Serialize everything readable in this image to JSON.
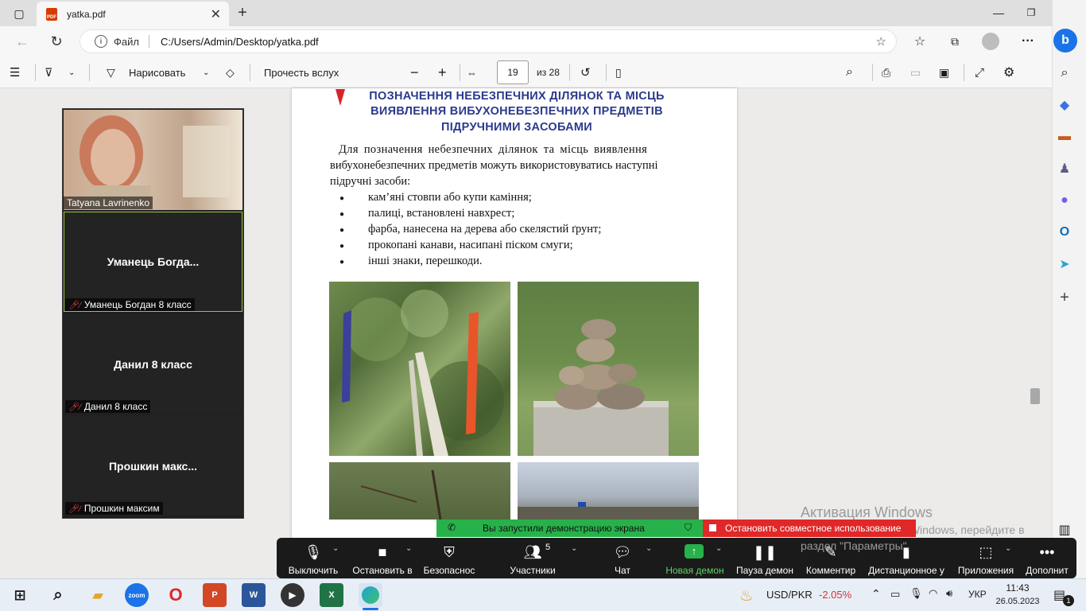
{
  "browser": {
    "tab_title": "yatka.pdf",
    "tab_close": "✕",
    "new_tab": "+",
    "address_label": "Файл",
    "address_url": "C:/Users/Admin/Desktop/yatka.pdf"
  },
  "pdf_toolbar": {
    "draw_label": "Нарисовать",
    "read_aloud": "Прочесть вслух",
    "zoom_out": "−",
    "zoom_in": "+",
    "page_current": "19",
    "page_total": "из 28"
  },
  "pdf": {
    "heading_line1": "ПОЗНАЧЕННЯ НЕБЕЗПЕЧНИХ ДІЛЯНОК ТА МІСЦЬ",
    "heading_line2": "ВИЯВЛЕННЯ ВИБУХОНЕБЕЗПЕЧНИХ ПРЕДМЕТІВ",
    "heading_line3": "ПІДРУЧНИМИ ЗАСОБАМИ",
    "para_line1": "Для позначення небезпечних ділянок та місць виявлення",
    "para_line2": "вибухонебезпечних предметів можуть використовуватись наступні",
    "para_line3": "підручні засоби:",
    "bullets": [
      "кам’яні стовпи або купи каміння;",
      "палиці, встановлені навхрест;",
      "фарба, нанесена на дерева або скелястий ґрунт;",
      "прокопані канави, насипані піском смуги;",
      "інші знаки, перешкоди."
    ]
  },
  "zoom": {
    "participants": [
      {
        "label": "Tatyana Lavrinenko"
      },
      {
        "display": "Уманець  Богда...",
        "label": "Уманець Богдан 8 класс"
      },
      {
        "display": "Данил 8 класс",
        "label": "Данил 8 класс"
      },
      {
        "display": "Прошкин  макс...",
        "label": "Прошкин максим"
      }
    ],
    "share_notice": "Вы запустили демонстрацию экрана",
    "stop_share": "Остановить совместное использование",
    "controls": {
      "mute": "Выключить",
      "video": "Остановить в",
      "security": "Безопаснос",
      "participants": "Участники",
      "participants_count": "5",
      "chat": "Чат",
      "new_share": "Новая демон",
      "pause_share": "Пауза демон",
      "annotate": "Комментир",
      "remote": "Дистанционное у",
      "apps": "Приложения",
      "more": "Дополнит"
    }
  },
  "watermark": {
    "title": "Активация Windows",
    "line2": "Чтобы активировать Windows, перейдите в",
    "line3": "раздел \"Параметры\"."
  },
  "taskbar": {
    "currency": "USD/PKR",
    "change": "-2.05%",
    "lang": "УКР",
    "time": "11:43",
    "date": "26.05.2023",
    "notifications": "1"
  },
  "colors": {
    "heading": "#2b3a8c",
    "accent_green": "#27b14a",
    "stop_red": "#e02828",
    "negative": "#d13438"
  }
}
